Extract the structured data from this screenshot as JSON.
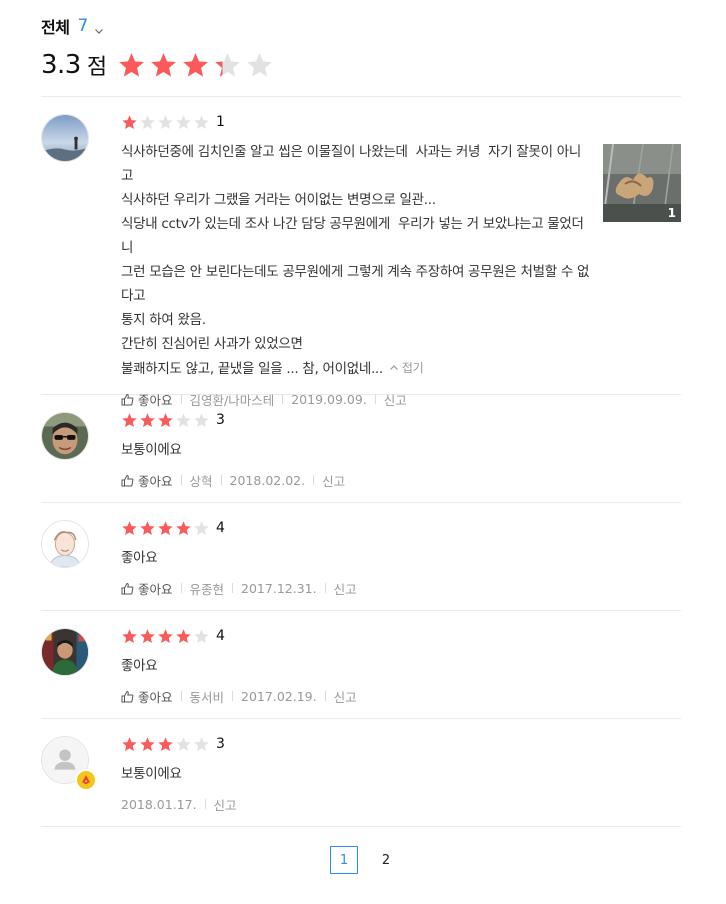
{
  "summary": {
    "filter_label": "전체",
    "total_count": "7",
    "score": "3.3",
    "score_unit": "점",
    "score_value": 3.3,
    "max_stars": 5,
    "star_color": "#fa5a5a",
    "star_empty_color": "#e2e2e2"
  },
  "reviews": [
    {
      "rating": 1,
      "rating_label": "1",
      "text_lines": [
        "식사하던중에 김치인줄 알고 씹은 이물질이 나왔는데  사과는 커녕  자기 잘못이 아니고",
        "식사하던 우리가 그랬을 거라는 어이없는 변명으로 일관...",
        "식당내 cctv가 있는데 조사 나간 담당 공무원에게  우리가 넣는 거 보았냐는고 물었더니",
        "그런 모습은 안 보린다는데도 공무원에게 그렇게 계속 주장하여 공무원은 처벌할 수 없다고",
        "통지 하여 왔음.",
        "간단히 진심어린 사과가 있었으면",
        "불쾌하지도 않고, 끝냈을 일을 ... 참, 어이없네..."
      ],
      "fold_label": "접기",
      "photo_count": "1",
      "like_label": "좋아요",
      "author": "김영환/나마스테",
      "date": "2019.09.09.",
      "report_label": "신고"
    },
    {
      "rating": 3,
      "rating_label": "3",
      "text": "보통이에요",
      "like_label": "좋아요",
      "author": "상혁",
      "date": "2018.02.02.",
      "report_label": "신고"
    },
    {
      "rating": 4,
      "rating_label": "4",
      "text": "좋아요",
      "like_label": "좋아요",
      "author": "유종현",
      "date": "2017.12.31.",
      "report_label": "신고"
    },
    {
      "rating": 4,
      "rating_label": "4",
      "text": "좋아요",
      "like_label": "좋아요",
      "author": "동서비",
      "date": "2017.02.19.",
      "report_label": "신고"
    },
    {
      "rating": 3,
      "rating_label": "3",
      "text": "보통이에요",
      "date": "2018.01.17.",
      "report_label": "신고"
    }
  ],
  "pagination": {
    "pages": [
      "1",
      "2"
    ],
    "current": "1"
  }
}
